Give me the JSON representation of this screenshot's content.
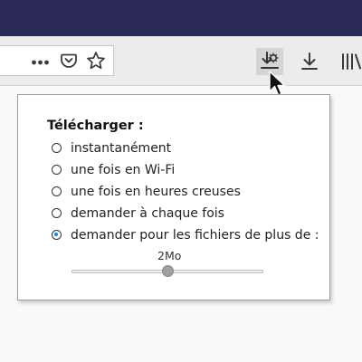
{
  "window": {
    "title_bar_color": "#2b2a56"
  },
  "toolbar": {
    "icons": [
      "more-icon",
      "pocket-icon",
      "bookmark-star-icon",
      "download-settings-icon",
      "download-icon",
      "library-icon"
    ],
    "more_glyph": "•••"
  },
  "panel": {
    "title": "Télécharger :",
    "options": [
      {
        "label": "instantanément",
        "checked": false
      },
      {
        "label": "une fois en Wi-Fi",
        "checked": false
      },
      {
        "label": "une fois en heures creuses",
        "checked": false
      },
      {
        "label": "demander à chaque fois",
        "checked": false
      },
      {
        "label": "demander pour les fichiers de plus de :",
        "checked": true
      }
    ],
    "slider": {
      "value_label": "2Mo",
      "position_fraction": 0.5
    },
    "accent_color": "#0a84ff"
  }
}
